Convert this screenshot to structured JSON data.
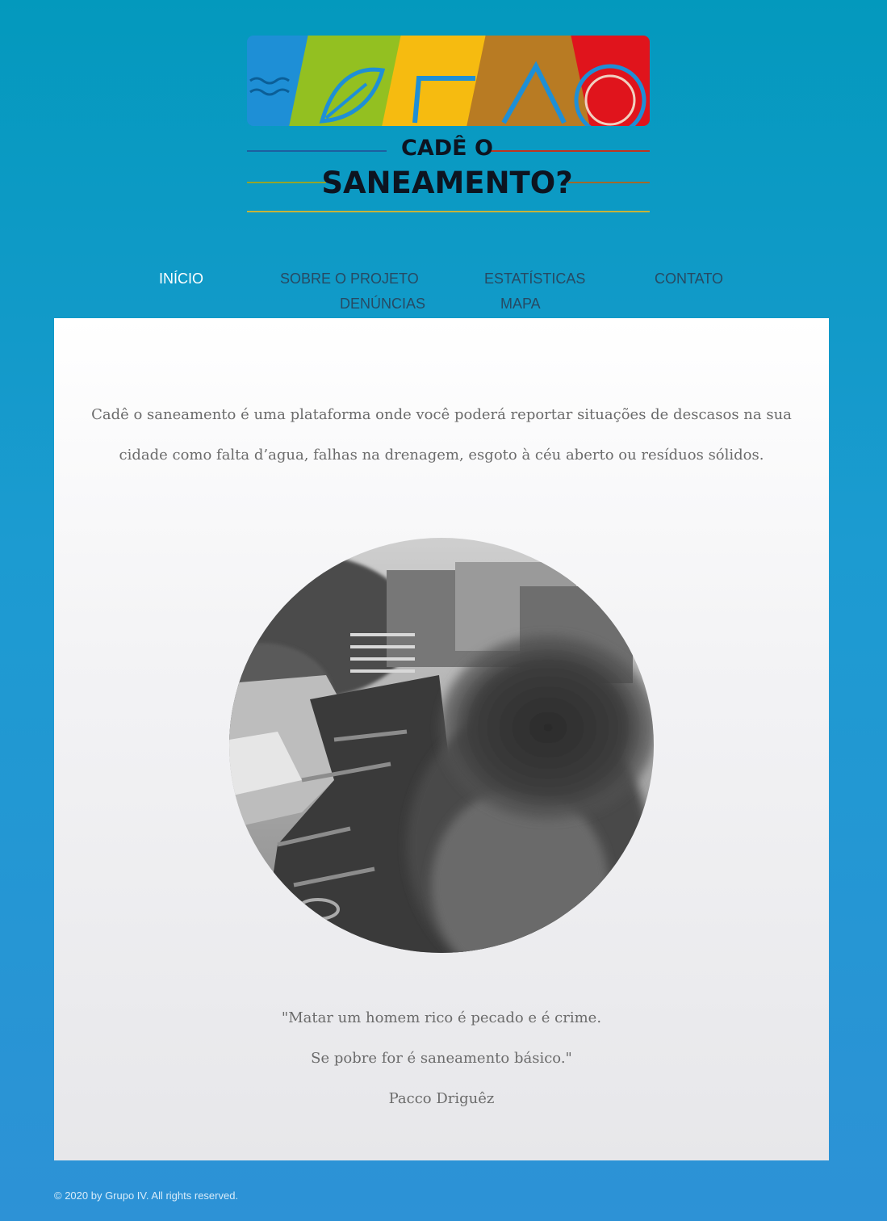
{
  "logo": {
    "line1": "CADÊ O",
    "line2": "SANEAMENTO?",
    "colors": [
      "#1e8fd6",
      "#93c021",
      "#f6bb10",
      "#b87b23",
      "#e0141c"
    ]
  },
  "nav": {
    "items": [
      {
        "label": "INÍCIO",
        "active": true
      },
      {
        "label": "SOBRE O PROJETO",
        "active": false
      },
      {
        "label": "ESTATÍSTICAS",
        "active": false
      },
      {
        "label": "CONTATO",
        "active": false
      },
      {
        "label": "DENÚNCIAS",
        "active": false
      },
      {
        "label": "MAPA",
        "active": false
      }
    ]
  },
  "main": {
    "intro": "Cadê o saneamento é uma plataforma onde você poderá reportar situações de descasos na sua cidade como falta d’agua, falhas na drenagem, esgoto à céu aberto ou resíduos sólidos.",
    "quote_line1": "\"Matar um homem rico é pecado e é crime.",
    "quote_line2": "Se pobre for é saneamento básico.\"",
    "quote_author": "Pacco Driguêz"
  },
  "footer": {
    "copyright": "© 2020 by Grupo IV. All rights reserved."
  }
}
